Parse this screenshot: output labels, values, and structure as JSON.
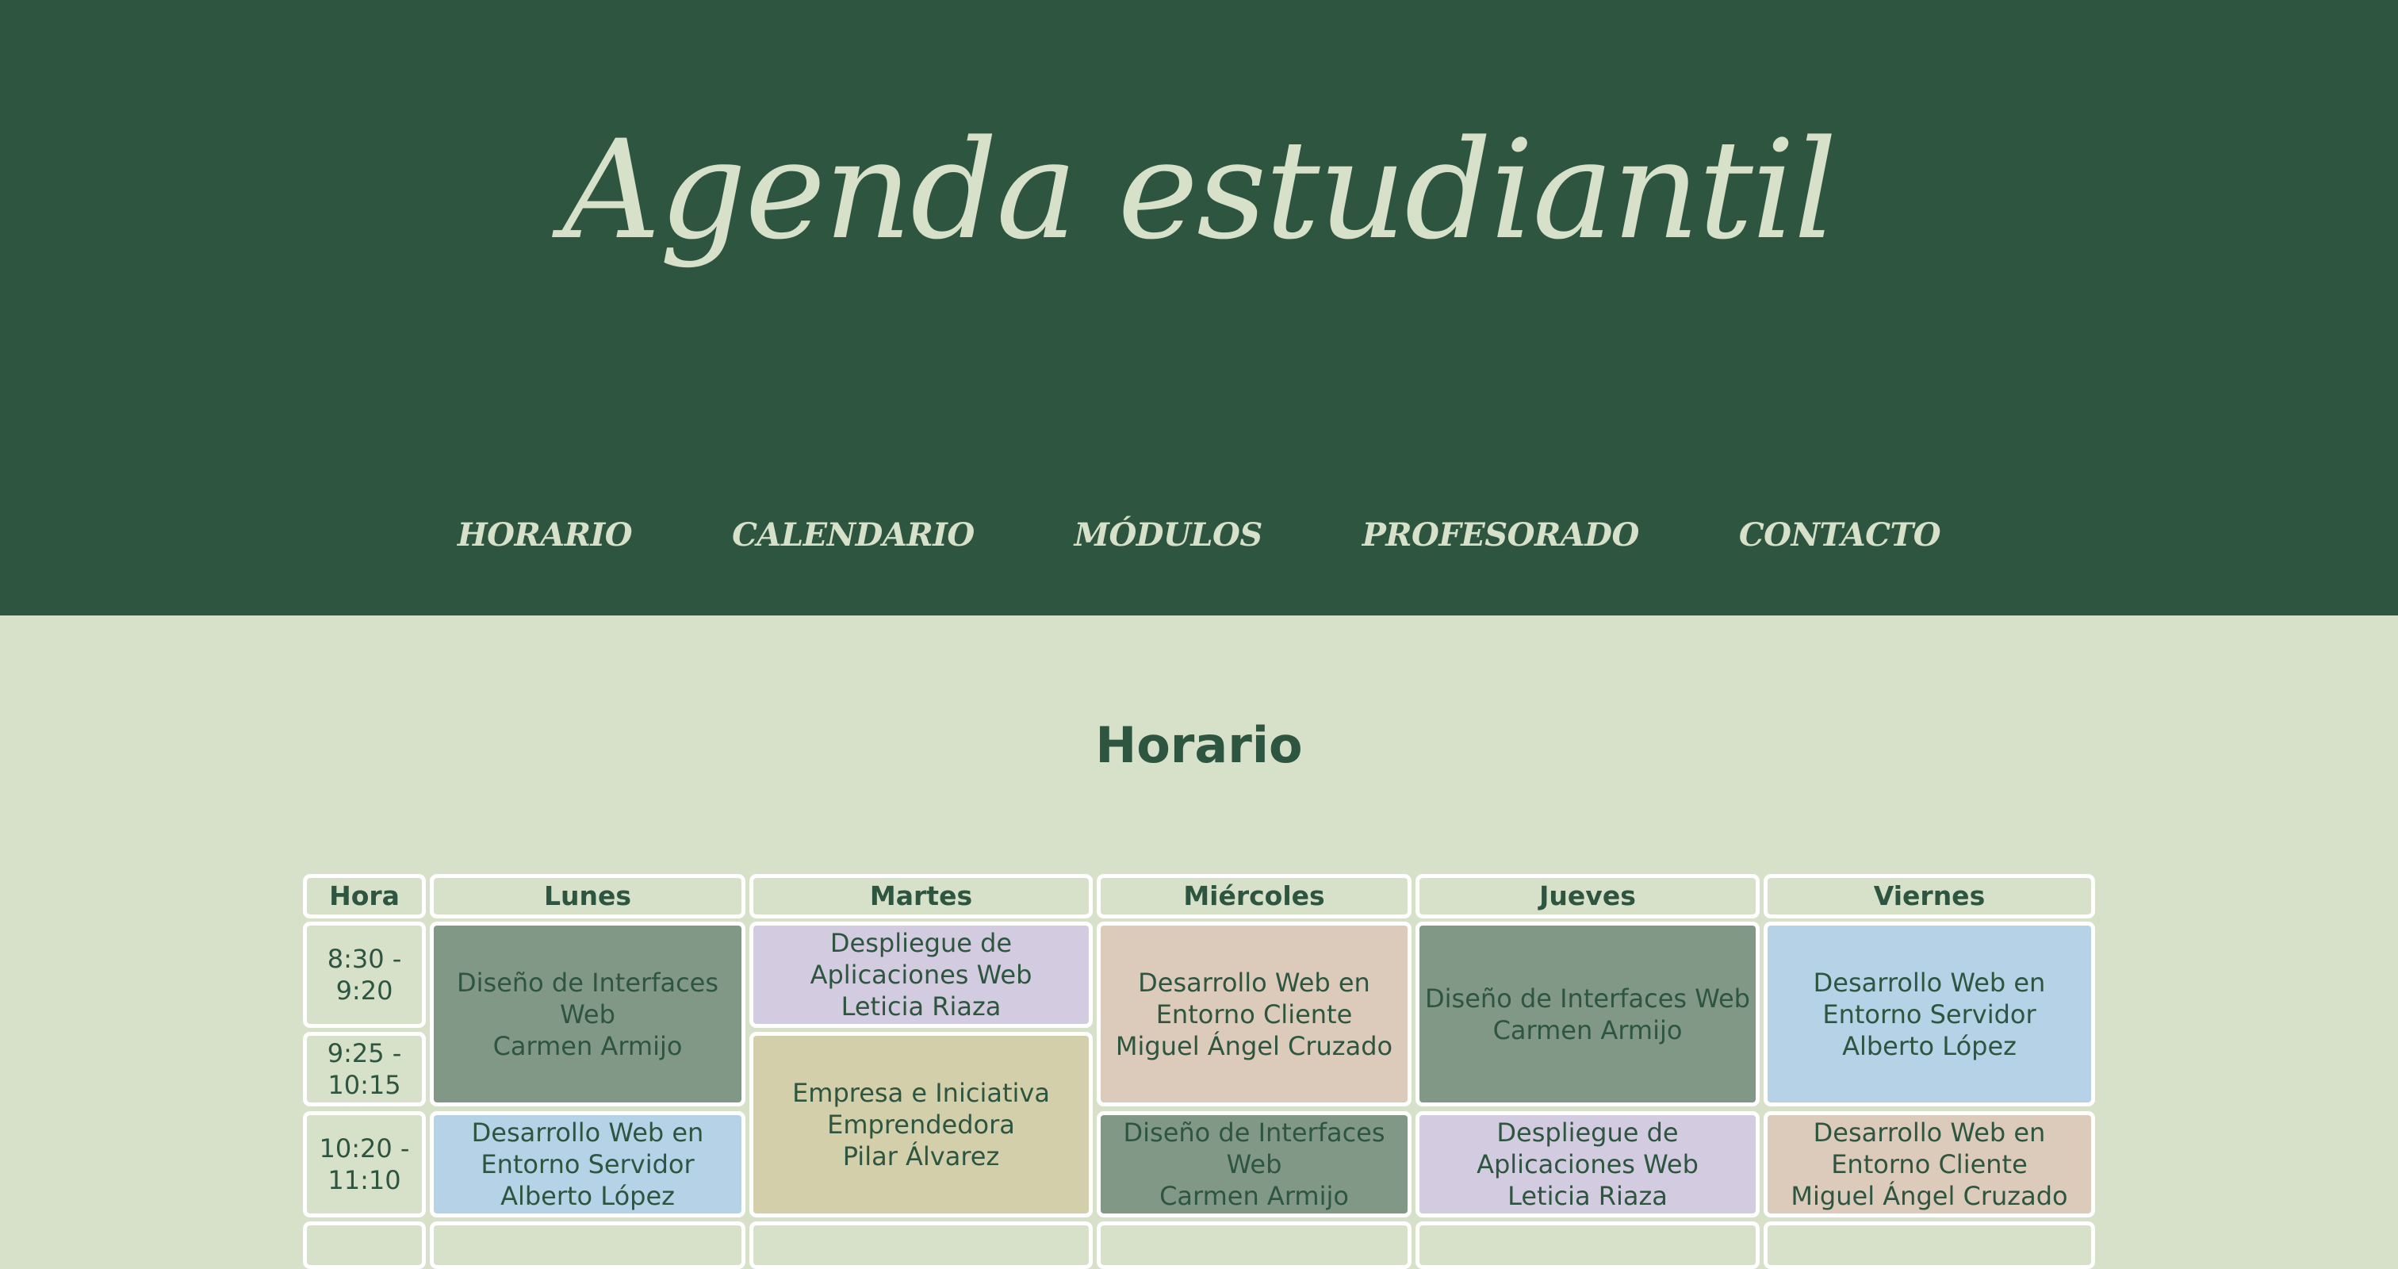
{
  "site": {
    "title": "Agenda estudiantil"
  },
  "nav": {
    "items": [
      {
        "label": "HORARIO"
      },
      {
        "label": "CALENDARIO"
      },
      {
        "label": "MÓDULOS"
      },
      {
        "label": "PROFESORADO"
      },
      {
        "label": "CONTACTO"
      }
    ]
  },
  "main": {
    "title": "Horario"
  },
  "colors": {
    "header_bg": "#2e5540",
    "page_bg": "#d7e1c9",
    "text_light": "#d7e1c9",
    "text_dark": "#2e5540",
    "interfaces": "#819887",
    "despliegue": "#d3cbdf",
    "cliente": "#dccbba",
    "servidor": "#b6d2e6",
    "empresa": "#d3cfab"
  },
  "schedule": {
    "headers": [
      "Hora",
      "Lunes",
      "Martes",
      "Miércoles",
      "Jueves",
      "Viernes"
    ],
    "hours": [
      {
        "start": "8:30 -",
        "end": "9:20"
      },
      {
        "start": "9:25 -",
        "end": "10:15"
      },
      {
        "start": "10:20 -",
        "end": "11:10"
      }
    ],
    "lunes": [
      {
        "lines": [
          "Diseño de Interfaces",
          "Web",
          "Carmen Armijo"
        ]
      },
      {
        "lines": [
          "Desarrollo Web en",
          "Entorno Servidor",
          "Alberto López"
        ]
      }
    ],
    "martes": [
      {
        "lines": [
          "Despliegue de",
          "Aplicaciones Web",
          "Leticia Riaza"
        ]
      },
      {
        "lines": [
          "Empresa e Iniciativa",
          "Emprendedora",
          "Pilar Álvarez"
        ]
      }
    ],
    "miercoles": [
      {
        "lines": [
          "Desarrollo Web en",
          "Entorno Cliente",
          "Miguel Ángel Cruzado"
        ]
      },
      {
        "lines": [
          "Diseño de Interfaces",
          "Web",
          "Carmen Armijo"
        ]
      }
    ],
    "jueves": [
      {
        "lines": [
          "Diseño de Interfaces Web",
          "Carmen Armijo"
        ]
      },
      {
        "lines": [
          "Despliegue de",
          "Aplicaciones Web",
          "Leticia Riaza"
        ]
      }
    ],
    "viernes": [
      {
        "lines": [
          "Desarrollo Web en",
          "Entorno Servidor",
          "Alberto López"
        ]
      },
      {
        "lines": [
          "Desarrollo Web en",
          "Entorno Cliente",
          "Miguel Ángel Cruzado"
        ]
      }
    ]
  }
}
